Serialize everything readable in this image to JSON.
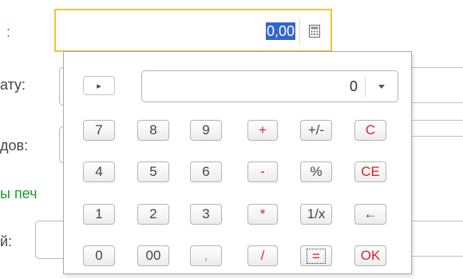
{
  "form": {
    "colon_mark": ":",
    "label_date": "ату:",
    "label_docs": "дов:",
    "label_print": "ы печ",
    "label_last": "й:",
    "amount_value": "0,00"
  },
  "calculator": {
    "display_value": "0",
    "buttons": {
      "memory": "▸",
      "n7": "7",
      "n8": "8",
      "n9": "9",
      "plus": "+",
      "sign": "+/-",
      "clear": "C",
      "n4": "4",
      "n5": "5",
      "n6": "6",
      "minus": "-",
      "percent": "%",
      "clear_entry": "CE",
      "n1": "1",
      "n2": "2",
      "n3": "3",
      "multiply": "*",
      "reciprocal": "1/x",
      "backspace": "←",
      "n0": "0",
      "n00": "00",
      "comma": ",",
      "divide": "/",
      "equals": "=",
      "ok": "OK"
    }
  },
  "icons": {
    "field_icon": "calculator-icon",
    "dropdown": "triangle-down-icon"
  },
  "colors": {
    "focus_border": "#f2c230",
    "selection": "#3366cc",
    "accent_red": "#e0202a",
    "green_text": "#1a9a2e",
    "link_blue": "#2d7fd3"
  }
}
